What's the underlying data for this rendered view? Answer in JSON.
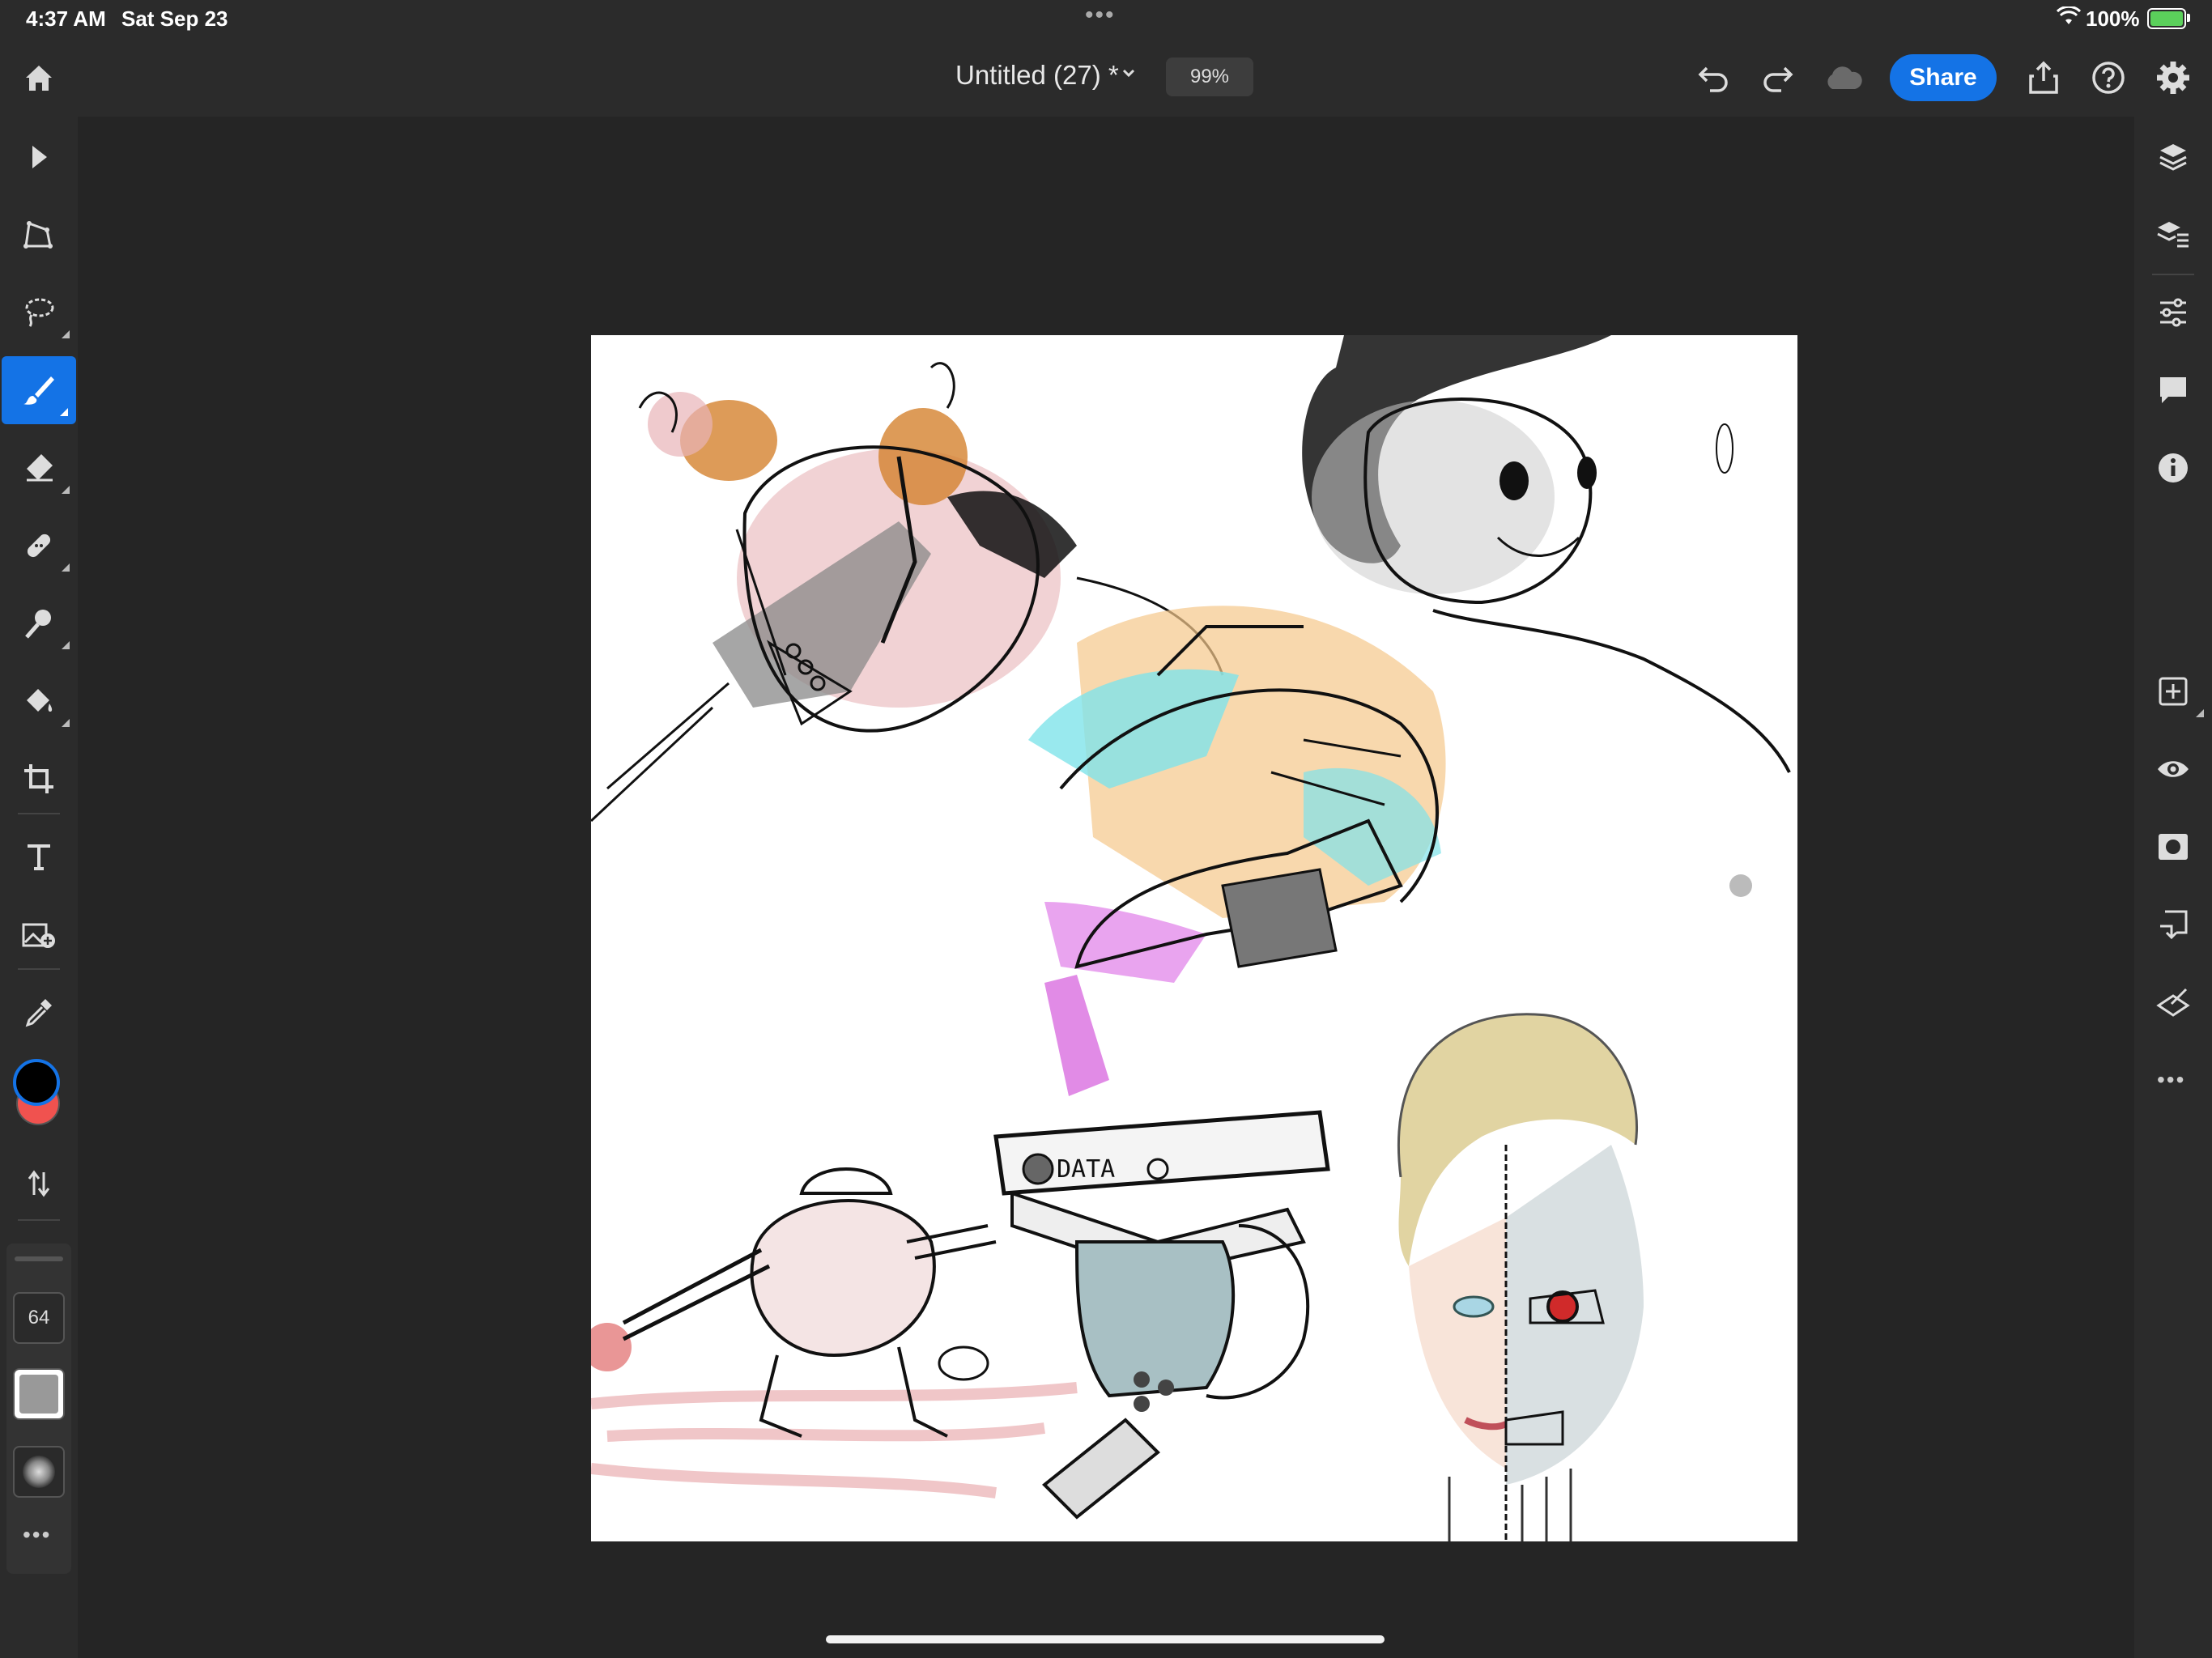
{
  "status_bar": {
    "time": "4:37 AM",
    "date": "Sat Sep 23",
    "battery": "100%"
  },
  "top_bar": {
    "document_title": "Untitled (27) *",
    "zoom": "99%",
    "share_label": "Share"
  },
  "left_toolbar": {
    "tools": [
      "select-icon",
      "transform-icon",
      "lasso-icon",
      "brush-icon",
      "eraser-icon",
      "healing-icon",
      "smudge-icon",
      "fill-icon",
      "crop-icon",
      "type-icon",
      "place-image-icon",
      "eyedropper-icon"
    ],
    "active_tool": "brush-icon",
    "foreground_color": "#000000",
    "background_color": "#f0524f",
    "brush_size": "64"
  },
  "right_panel": {
    "icons": [
      "layers-icon",
      "layer-properties-icon",
      "adjustments-icon",
      "comments-icon",
      "info-icon",
      "add-layer-icon",
      "visibility-icon",
      "mask-icon",
      "merge-icon",
      "clear-icon",
      "more-icon"
    ]
  },
  "colors": {
    "accent": "#1473e6",
    "toolbar_bg": "#2b2b2b",
    "workspace_bg": "#252525"
  }
}
